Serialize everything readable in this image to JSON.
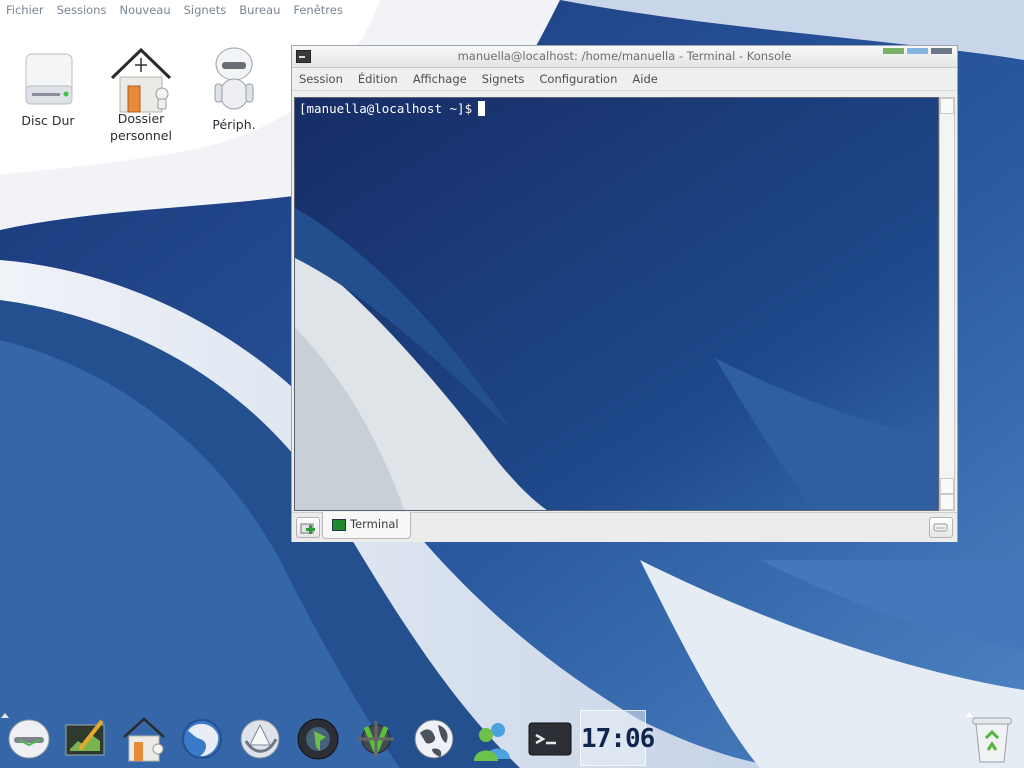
{
  "top_menu": [
    "Fichier",
    "Sessions",
    "Nouveau",
    "Signets",
    "Bureau",
    "Fenêtres"
  ],
  "desktop_icons": {
    "disc": "Disc Dur",
    "home_line1": "Dossier",
    "home_line2": "personnel",
    "devices": "Périph."
  },
  "konsole": {
    "title": "manuella@localhost: /home/manuella - Terminal - Konsole",
    "menus": [
      "Session",
      "Édition",
      "Affichage",
      "Signets",
      "Configuration",
      "Aide"
    ],
    "prompt": "[manuella@localhost ~]$",
    "tab_label": "Terminal",
    "button_colors": [
      "#7bb36a",
      "#86b4e0",
      "#6e7889"
    ]
  },
  "dock": {
    "icons": [
      "kde-menu-icon",
      "editor-icon",
      "home-folder-icon",
      "firefox-icon",
      "web-browser-icon",
      "media-player-icon",
      "config-tool-icon",
      "globe-icon",
      "messenger-icon",
      "terminal-icon"
    ],
    "clock": "17:06",
    "trash": "trash-icon"
  },
  "colors": {
    "desktop_dark": "#14306f",
    "desktop_mid": "#2d5d9c",
    "terminal_text": "#ffffff"
  }
}
